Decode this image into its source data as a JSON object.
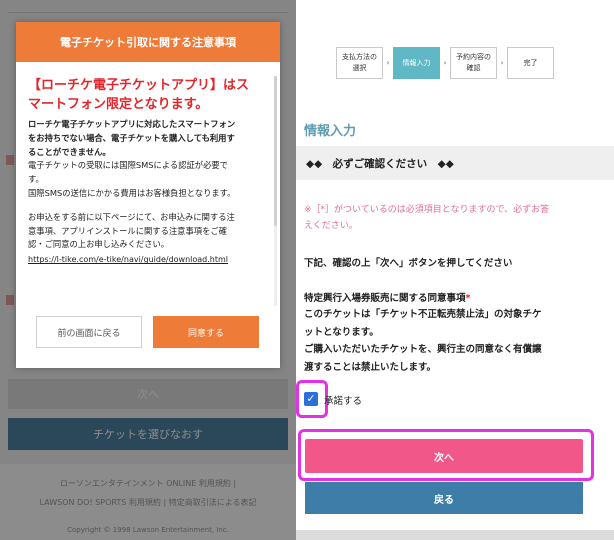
{
  "modal": {
    "title": "電子チケット引取に関する注意事項",
    "lead_1": "【ローチケ電子チケットアプリ】はス",
    "lead_2": "マートフォン限定となります。",
    "bold_1": "ローチケ電子チケットアプリに対応したスマートフォン",
    "bold_2": "をお持ちでない場合、電子チケットを購入しても利用す",
    "bold_3": "ることができません。",
    "para2_1": "電子チケットの受取には国際SMSによる認証が必要で",
    "para2_2": "す。",
    "para3": "国際SMSの送信にかかる費用はお客様負担となります。",
    "para4_1": "お申込をする前に以下ページにて、お申込みに関する注",
    "para4_2": "意事項、アプリインストールに関する注意事項をご確",
    "para4_3": "認・ご同意の上お申し込みください。",
    "link": "https://l-tike.com/e-tike/navi/guide/download.html",
    "back_button": "前の画面に戻る",
    "agree_button": "同意する"
  },
  "left_background": {
    "next_button": "次へ",
    "reselect_button": "チケットを選びなおす",
    "footer_1": "ローソンエンタテインメント ONLINE 利用規約 |",
    "footer_2": "LAWSON DO! SPORTS 利用規約 | 特定商取引法による表記",
    "footer_3": "Copyright © 1998 Lawson Entertainment, Inc."
  },
  "steps": [
    {
      "label_1": "支払方法の",
      "label_2": "選択",
      "arrow": "›"
    },
    {
      "label_1": "情報入力",
      "label_2": "",
      "arrow": "›"
    },
    {
      "label_1": "予約内容の",
      "label_2": "確認",
      "arrow": "›"
    },
    {
      "label_1": "完了",
      "label_2": "",
      "arrow": ""
    }
  ],
  "form": {
    "section_title": "情報入力",
    "confirm_bar": "◆◆　必ずご確認ください　◆◆",
    "required_note_1": "※［*］がついているのは必須項目となりますので、必ずお答",
    "required_note_2": "えください。",
    "instruction": "下記、確認の上「次へ」ボタンを押してください",
    "agreement_title": "特定興行入場券販売に関する同意事項",
    "required_mark": "*",
    "agreement_1": "このチケットは「チケット不正転売禁止法」の対象チケ",
    "agreement_2": "ットとなります。",
    "agreement_3": "ご購入いただいたチケットを、興行主の同意なく有償譲",
    "agreement_4": "渡することは禁止いたします。",
    "checkbox_label": "承諾する",
    "checkbox_checked": true,
    "next_button": "次へ",
    "back_button": "戻る"
  },
  "colors": {
    "modal_accent": "#ef7b39",
    "warning_red": "#e3262b",
    "active_step": "#5fb8c4",
    "next_pink": "#f2578a",
    "back_blue": "#3e7da7",
    "highlight_magenta": "#e231e6"
  }
}
